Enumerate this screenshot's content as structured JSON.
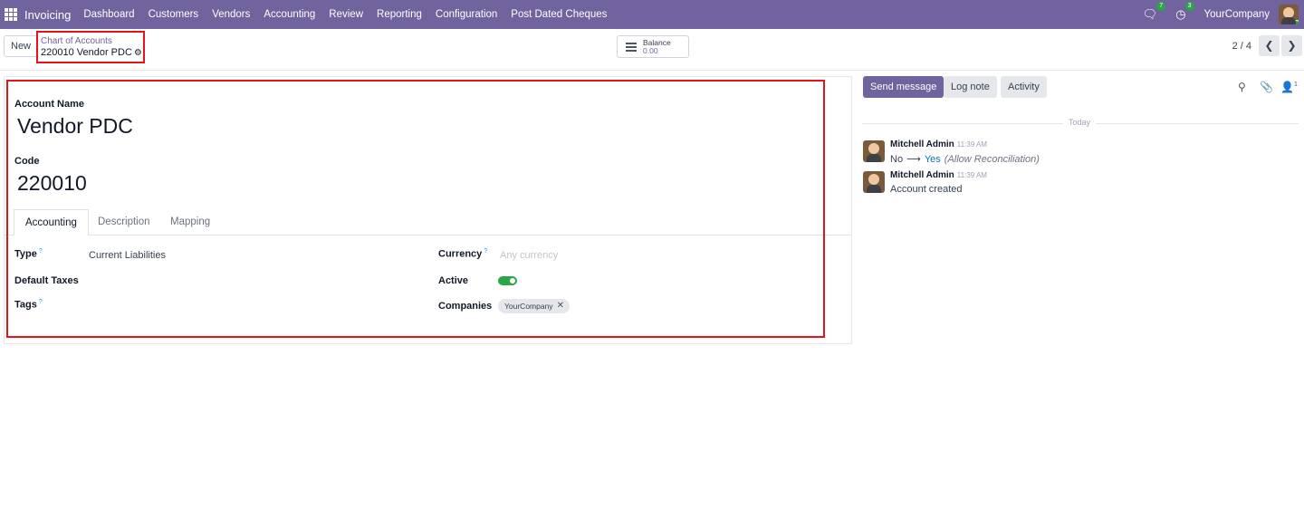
{
  "navbar": {
    "app_name": "Invoicing",
    "menu": [
      "Dashboard",
      "Customers",
      "Vendors",
      "Accounting",
      "Review",
      "Reporting",
      "Configuration",
      "Post Dated Cheques"
    ],
    "messages_count": "7",
    "activities_count": "3",
    "company": "YourCompany"
  },
  "control": {
    "new_label": "New",
    "breadcrumb_parent": "Chart of Accounts",
    "breadcrumb_current": "220010 Vendor PDC",
    "balance_label": "Balance",
    "balance_value": "0.00",
    "pager": "2 / 4"
  },
  "form": {
    "account_name_label": "Account Name",
    "account_name": "Vendor PDC",
    "code_label": "Code",
    "code": "220010",
    "tabs": [
      "Accounting",
      "Description",
      "Mapping"
    ],
    "type_label": "Type",
    "type_value": "Current Liabilities",
    "default_taxes_label": "Default Taxes",
    "tags_label": "Tags",
    "currency_label": "Currency",
    "currency_placeholder": "Any currency",
    "active_label": "Active",
    "active": true,
    "companies_label": "Companies",
    "company_tag": "YourCompany",
    "help_mark": "?"
  },
  "chatter": {
    "send_message": "Send message",
    "log_note": "Log note",
    "activity": "Activity",
    "followers_count": "1",
    "date_separator": "Today",
    "messages": [
      {
        "author": "Mitchell Admin",
        "time": "11:39 AM",
        "old_value": "No",
        "new_value": "Yes",
        "field": "(Allow Reconciliation)"
      },
      {
        "author": "Mitchell Admin",
        "time": "11:39 AM",
        "body": "Account created"
      }
    ]
  },
  "colors": {
    "brand": "#71639e",
    "highlight": "#e3141c",
    "success": "#28a745",
    "link": "#0077b6"
  }
}
